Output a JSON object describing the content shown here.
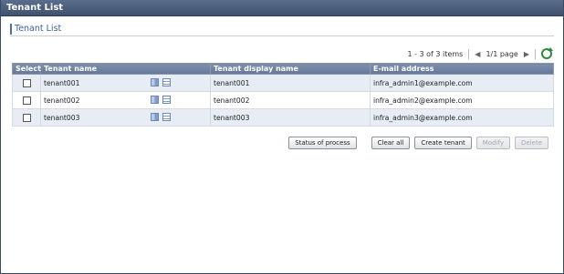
{
  "window": {
    "title": "Tenant List"
  },
  "section": {
    "title": "Tenant List"
  },
  "pager": {
    "items_summary": "1 - 3 of 3 items",
    "page_summary": "1/1 page",
    "prev_glyph": "◀",
    "next_glyph": "▶"
  },
  "table": {
    "columns": [
      "Select",
      "Tenant name",
      "Tenant display name",
      "E-mail address"
    ],
    "rows": [
      {
        "name": "tenant001",
        "display": "tenant001",
        "email": "infra_admin1@example.com"
      },
      {
        "name": "tenant002",
        "display": "tenant002",
        "email": "infra_admin2@example.com"
      },
      {
        "name": "tenant003",
        "display": "tenant003",
        "email": "infra_admin3@example.com"
      }
    ]
  },
  "buttons": {
    "status": "Status of process",
    "clear": "Clear all",
    "create": "Create tenant",
    "modify": "Modify",
    "delete": "Delete"
  },
  "icons": [
    "building-icon",
    "list-icon",
    "refresh-icon"
  ],
  "colors": {
    "header_bg": "#64779a",
    "accent": "#3b5f9a",
    "refresh": "#2e8a3a"
  }
}
